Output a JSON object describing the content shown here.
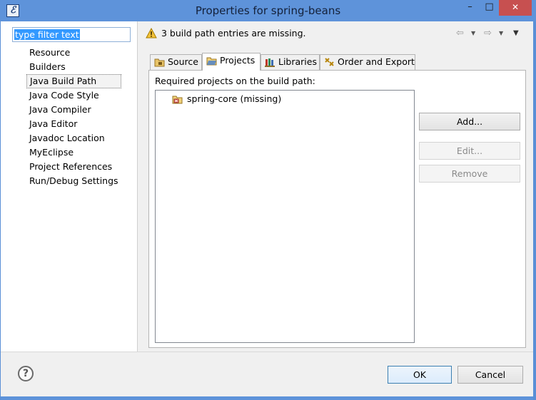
{
  "window": {
    "title": "Properties for spring-beans",
    "app_icon": "eclipse-icon",
    "min_glyph": "–",
    "max_glyph": "□",
    "close_glyph": "✕"
  },
  "filter": {
    "value": "type filter text"
  },
  "tree": {
    "items": [
      {
        "label": "Resource"
      },
      {
        "label": "Builders"
      },
      {
        "label": "Java Build Path"
      },
      {
        "label": "Java Code Style"
      },
      {
        "label": "Java Compiler"
      },
      {
        "label": "Java Editor"
      },
      {
        "label": "Javadoc Location"
      },
      {
        "label": "MyEclipse"
      },
      {
        "label": "Project References"
      },
      {
        "label": "Run/Debug Settings"
      }
    ],
    "selected_index": 2
  },
  "header": {
    "message": "3 build path entries are missing.",
    "icon": "warning-icon"
  },
  "nav": {
    "back_glyph": "⇦",
    "forward_glyph": "⇨",
    "dropdown_glyph": "▼",
    "menu_glyph": "▼"
  },
  "tabs": [
    {
      "label": "Source",
      "icon": "source-folder-icon"
    },
    {
      "label": "Projects",
      "icon": "project-folder-icon",
      "active": true
    },
    {
      "label": "Libraries",
      "icon": "libraries-icon"
    },
    {
      "label": "Order and Export",
      "icon": "order-export-icon"
    }
  ],
  "projects_panel": {
    "label": "Required projects on the build path:",
    "items": [
      {
        "label": "spring-core (missing)",
        "icon": "missing-project-icon"
      }
    ]
  },
  "buttons": {
    "add": "Add...",
    "edit": "Edit...",
    "remove": "Remove",
    "ok": "OK",
    "cancel": "Cancel",
    "help": "?"
  },
  "colors": {
    "titlebar": "#5e93da",
    "close": "#c75050",
    "selection": "#3399ff"
  }
}
